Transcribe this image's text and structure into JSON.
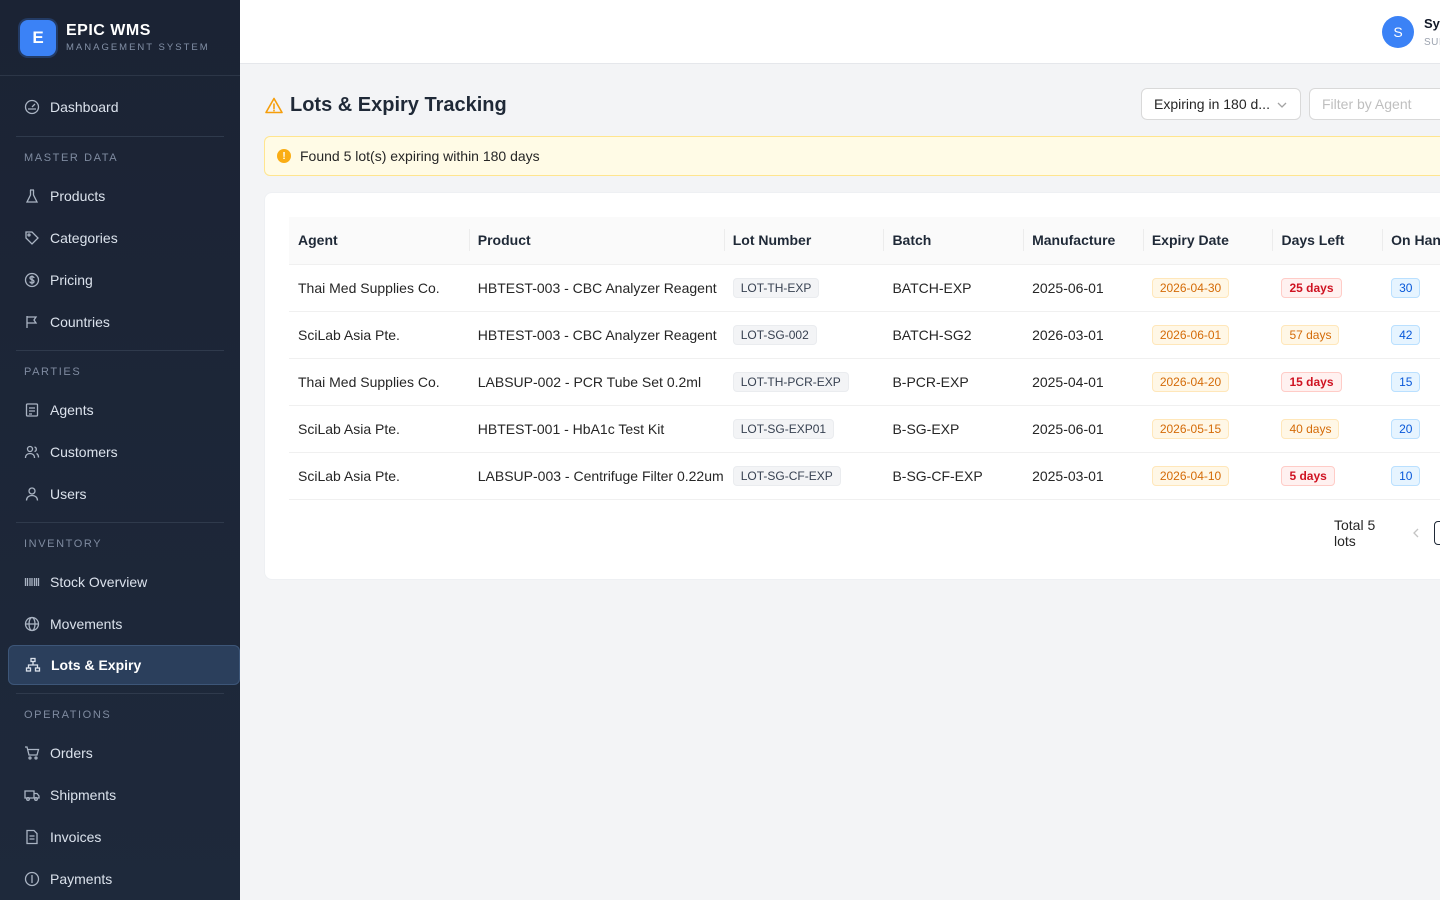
{
  "brand": {
    "logo": "E",
    "title": "EPIC WMS",
    "subtitle": "MANAGEMENT SYSTEM"
  },
  "sidebar": {
    "dashboard": "Dashboard",
    "sections": [
      {
        "title": "MASTER DATA",
        "items": [
          "Products",
          "Categories",
          "Pricing",
          "Countries"
        ]
      },
      {
        "title": "PARTIES",
        "items": [
          "Agents",
          "Customers",
          "Users"
        ]
      },
      {
        "title": "INVENTORY",
        "items": [
          "Stock Overview",
          "Movements",
          "Lots & Expiry"
        ]
      },
      {
        "title": "OPERATIONS",
        "items": [
          "Orders",
          "Shipments",
          "Invoices",
          "Payments"
        ]
      }
    ],
    "active": "Lots & Expiry"
  },
  "header": {
    "avatar": "S",
    "user_name": "Sys",
    "user_role": "SUI"
  },
  "page": {
    "title": "Lots & Expiry Tracking",
    "expiry_filter": "Expiring in 180 d...",
    "agent_filter_placeholder": "Filter by Agent",
    "alert": "Found 5 lot(s) expiring within 180 days"
  },
  "table": {
    "columns": [
      "Agent",
      "Product",
      "Lot Number",
      "Batch",
      "Manufacture",
      "Expiry Date",
      "Days Left",
      "On Han"
    ],
    "rows": [
      {
        "agent": "Thai Med Supplies Co.",
        "product": "HBTEST-003 - CBC Analyzer Reagent",
        "lot": "LOT-TH-EXP",
        "batch": "BATCH-EXP",
        "manufacture": "2025-06-01",
        "expiry": "2026-04-30",
        "days_left": "25 days",
        "severity": "red",
        "on_hand": "30"
      },
      {
        "agent": "SciLab Asia Pte.",
        "product": "HBTEST-003 - CBC Analyzer Reagent",
        "lot": "LOT-SG-002",
        "batch": "BATCH-SG2",
        "manufacture": "2026-03-01",
        "expiry": "2026-06-01",
        "days_left": "57 days",
        "severity": "orange",
        "on_hand": "42"
      },
      {
        "agent": "Thai Med Supplies Co.",
        "product": "LABSUP-002 - PCR Tube Set 0.2ml",
        "lot": "LOT-TH-PCR-EXP",
        "batch": "B-PCR-EXP",
        "manufacture": "2025-04-01",
        "expiry": "2026-04-20",
        "days_left": "15 days",
        "severity": "red",
        "on_hand": "15"
      },
      {
        "agent": "SciLab Asia Pte.",
        "product": "HBTEST-001 - HbA1c Test Kit",
        "lot": "LOT-SG-EXP01",
        "batch": "B-SG-EXP",
        "manufacture": "2025-06-01",
        "expiry": "2026-05-15",
        "days_left": "40 days",
        "severity": "orange",
        "on_hand": "20"
      },
      {
        "agent": "SciLab Asia Pte.",
        "product": "LABSUP-003 - Centrifuge Filter 0.22um",
        "lot": "LOT-SG-CF-EXP",
        "batch": "B-SG-CF-EXP",
        "manufacture": "2025-03-01",
        "expiry": "2026-04-10",
        "days_left": "5 days",
        "severity": "red",
        "on_hand": "10"
      }
    ]
  },
  "pagination": {
    "total": "Total 5 lots"
  },
  "icons": {
    "dashboard": "dashboard-icon",
    "products": "flask-icon",
    "categories": "tag-icon",
    "pricing": "dollar-icon",
    "countries": "flag-icon",
    "agents": "id-card-icon",
    "customers": "team-icon",
    "users": "user-icon",
    "stock": "barcode-icon",
    "movements": "globe-icon",
    "lots": "cluster-icon",
    "orders": "cart-icon",
    "shipments": "truck-icon",
    "invoices": "file-icon",
    "payments": "coin-icon"
  }
}
